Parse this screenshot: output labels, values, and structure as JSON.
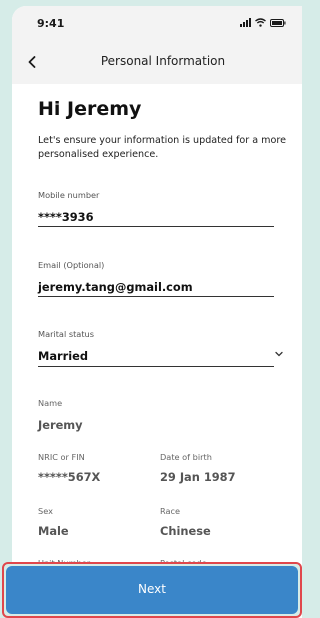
{
  "status": {
    "time": "9:41"
  },
  "nav": {
    "title": "Personal Information"
  },
  "header": {
    "greeting": "Hi Jeremy",
    "intro": "Let's ensure your information is updated for a more personalised experience."
  },
  "form": {
    "mobile": {
      "label": "Mobile number",
      "value": "****3936"
    },
    "email": {
      "label": "Email (Optional)",
      "value": "jeremy.tang@gmail.com"
    },
    "marital": {
      "label": "Marital status",
      "value": "Married"
    }
  },
  "details": {
    "name": {
      "label": "Name",
      "value": "Jeremy"
    },
    "nric": {
      "label": "NRIC or FIN",
      "value": "*****567X"
    },
    "dob": {
      "label": "Date of birth",
      "value": "29 Jan 1987"
    },
    "sex": {
      "label": "Sex",
      "value": "Male"
    },
    "race": {
      "label": "Race",
      "value": "Chinese"
    },
    "unit": {
      "label": "Unit Number"
    },
    "postal": {
      "label": "Postal code"
    }
  },
  "actions": {
    "next_label": "Next"
  },
  "colors": {
    "accent": "#3a86c9",
    "highlight": "#e0474c",
    "background": "#d6ece8"
  }
}
